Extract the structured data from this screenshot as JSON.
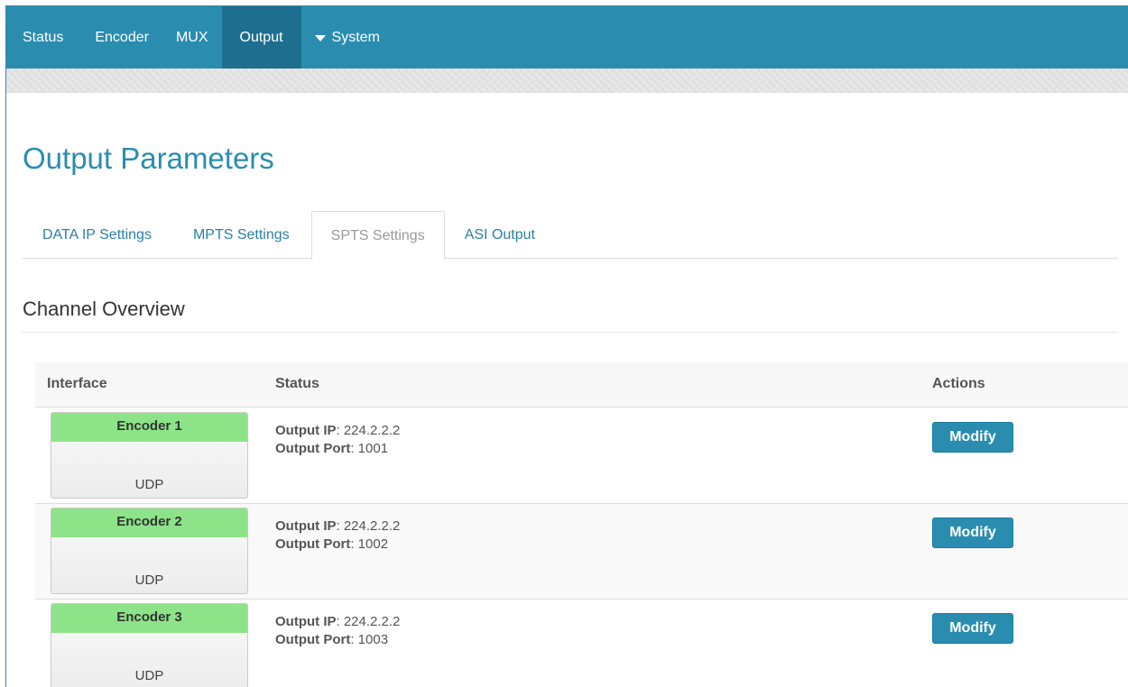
{
  "nav": {
    "items": [
      "Status",
      "Encoder",
      "MUX",
      "Output"
    ],
    "system_label": "System",
    "active": "Output"
  },
  "page": {
    "title": "Output Parameters"
  },
  "tabs": [
    {
      "label": "DATA IP Settings"
    },
    {
      "label": "MPTS Settings"
    },
    {
      "label": "SPTS Settings"
    },
    {
      "label": "ASI Output"
    }
  ],
  "active_tab": "SPTS Settings",
  "section": {
    "title": "Channel Overview"
  },
  "table": {
    "headers": {
      "interface": "Interface",
      "status": "Status",
      "actions": "Actions"
    },
    "status_labels": {
      "ip": "Output IP",
      "port": "Output Port"
    },
    "rows": [
      {
        "name": "Encoder 1",
        "protocol": "UDP",
        "ip": "224.2.2.2",
        "port": "1001",
        "action": "Modify"
      },
      {
        "name": "Encoder 2",
        "protocol": "UDP",
        "ip": "224.2.2.2",
        "port": "1002",
        "action": "Modify"
      },
      {
        "name": "Encoder 3",
        "protocol": "UDP",
        "ip": "224.2.2.2",
        "port": "1003",
        "action": "Modify"
      }
    ]
  },
  "colors": {
    "navbar": "#2a8db0",
    "nav_active": "#1e6f8f",
    "accent": "#2a8db0",
    "encoder_header": "#8de388"
  }
}
